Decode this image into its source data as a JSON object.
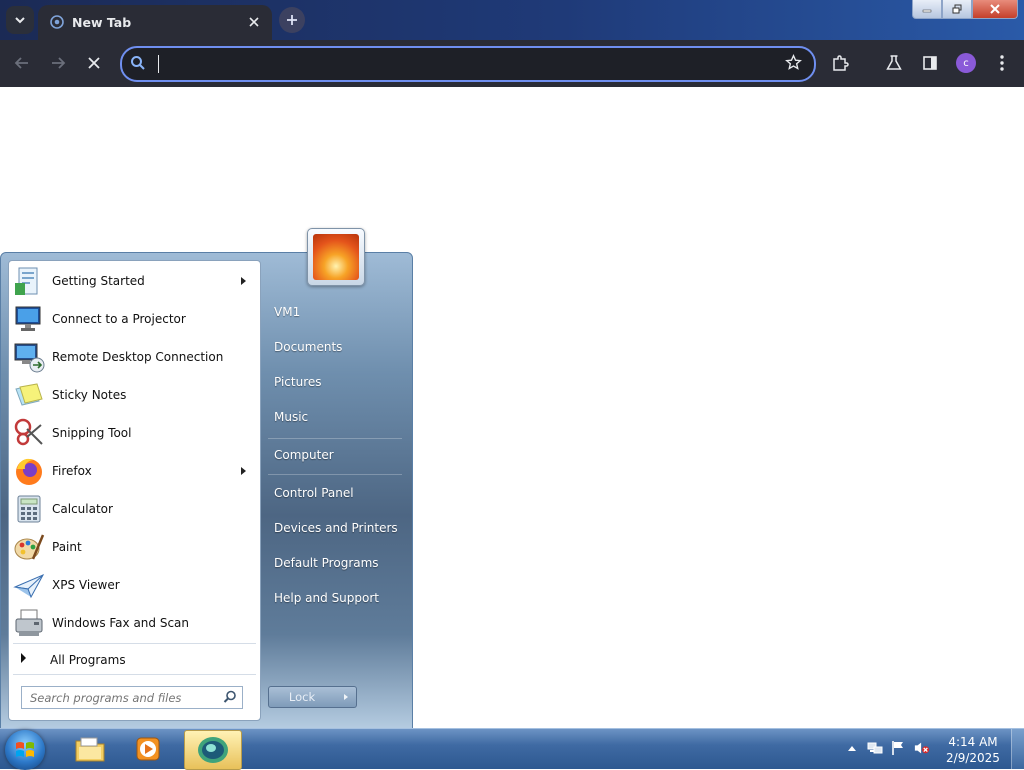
{
  "browser": {
    "tab": {
      "title": "New Tab"
    },
    "omnibox": {
      "value": "",
      "placeholder": ""
    },
    "profile_initial": "c"
  },
  "start_menu": {
    "programs": [
      {
        "label": "Getting Started",
        "icon": "getting-started-icon",
        "submenu": true
      },
      {
        "label": "Connect to a Projector",
        "icon": "projector-icon",
        "submenu": false
      },
      {
        "label": "Remote Desktop Connection",
        "icon": "remote-desktop-icon",
        "submenu": false
      },
      {
        "label": "Sticky Notes",
        "icon": "sticky-notes-icon",
        "submenu": false
      },
      {
        "label": "Snipping Tool",
        "icon": "snipping-tool-icon",
        "submenu": false
      },
      {
        "label": "Firefox",
        "icon": "firefox-icon",
        "submenu": true
      },
      {
        "label": "Calculator",
        "icon": "calculator-icon",
        "submenu": false
      },
      {
        "label": "Paint",
        "icon": "paint-icon",
        "submenu": false
      },
      {
        "label": "XPS Viewer",
        "icon": "xps-viewer-icon",
        "submenu": false
      },
      {
        "label": "Windows Fax and Scan",
        "icon": "fax-scan-icon",
        "submenu": false
      }
    ],
    "all_programs": "All Programs",
    "search_placeholder": "Search programs and files",
    "right_items": {
      "user": "VM1",
      "documents": "Documents",
      "pictures": "Pictures",
      "music": "Music",
      "computer": "Computer",
      "control_panel": "Control Panel",
      "devices_printers": "Devices and Printers",
      "default_programs": "Default Programs",
      "help_support": "Help and Support"
    },
    "power_button": "Lock"
  },
  "taskbar": {
    "clock_time": "4:14 AM",
    "clock_date": "2/9/2025"
  }
}
